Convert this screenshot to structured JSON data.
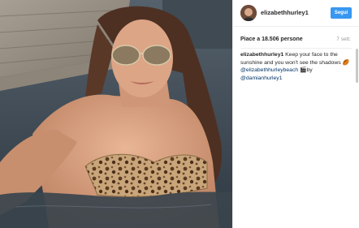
{
  "post": {
    "photo_alt": "",
    "header": {
      "username": "elizabethhurley1",
      "follow_label": "Segui"
    },
    "likes": "Piace a 18.506 persone",
    "time": "7 sett.",
    "caption": {
      "username": "elizabethhurley1",
      "text": " Keep your face to the sunshine and you won't see the shadows",
      "emoji1": "🏉",
      "mention1": "@elizabethhurleybeach",
      "emoji2": "🎬",
      "by": "by",
      "mention2": "@damianhurley1"
    }
  }
}
